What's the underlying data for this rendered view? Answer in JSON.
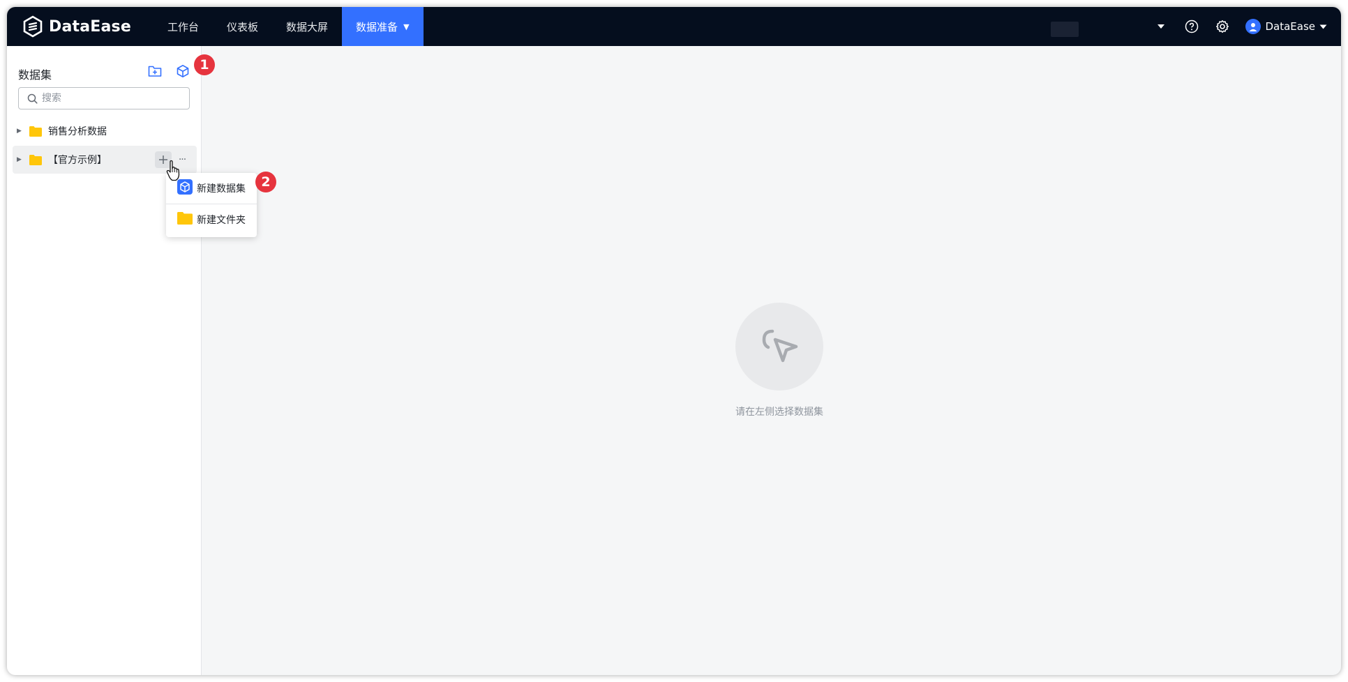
{
  "app": {
    "logo_text": "DataEase"
  },
  "nav": {
    "items": [
      {
        "label": "工作台"
      },
      {
        "label": "仪表板"
      },
      {
        "label": "数据大屏"
      },
      {
        "label": "数据准备",
        "active": true
      }
    ]
  },
  "header": {
    "user_name": "DataEase"
  },
  "sidebar": {
    "title": "数据集",
    "search_placeholder": "搜索",
    "tree": [
      {
        "label": "销售分析数据"
      },
      {
        "label": "【官方示例】"
      }
    ]
  },
  "context_menu": {
    "items": [
      {
        "label": "新建数据集",
        "icon": "dataset-cube-icon"
      },
      {
        "label": "新建文件夹",
        "icon": "folder-icon"
      }
    ]
  },
  "badges": {
    "one": "1",
    "two": "2"
  },
  "main": {
    "empty_text": "请在左侧选择数据集"
  },
  "colors": {
    "accent": "#3370ff",
    "topbar": "#050e1e",
    "badge": "#e6343e",
    "folder": "#ffc60a"
  }
}
